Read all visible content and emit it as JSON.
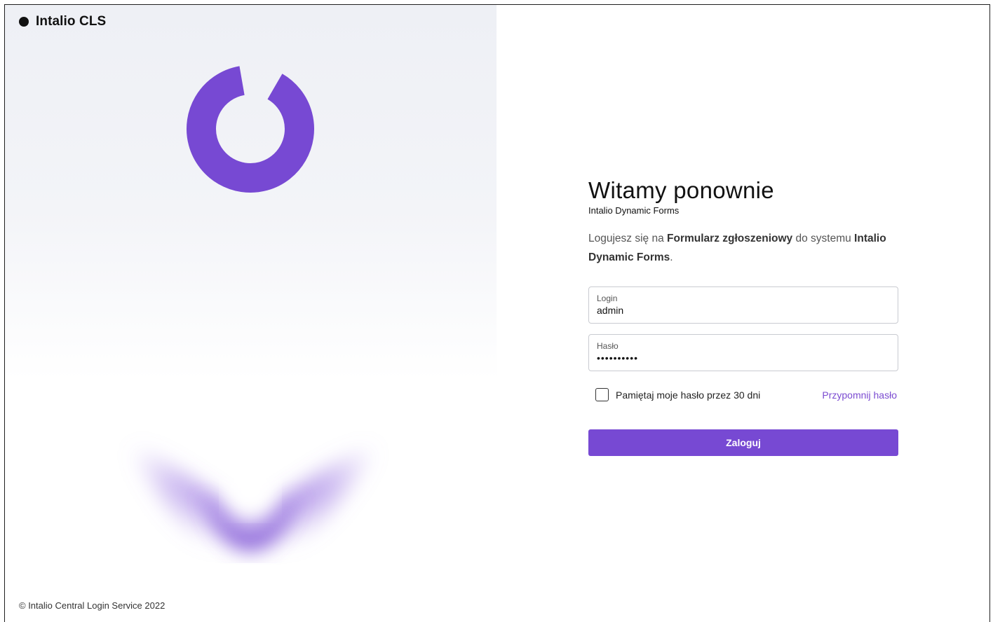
{
  "brand": {
    "name": "Intalio CLS"
  },
  "login": {
    "heading": "Witamy ponownie",
    "subheading": "Intalio Dynamic Forms",
    "description": {
      "part1": "Logujesz się na ",
      "form_name": "Formularz zgłoszeniowy",
      "part2": " do systemu ",
      "system_name": "Intalio Dynamic Forms",
      "part3": "."
    },
    "login_field": {
      "label": "Login",
      "value": "admin"
    },
    "password_field": {
      "label": "Hasło",
      "value": "••••••••••"
    },
    "remember_label": "Pamiętaj moje hasło przez 30 dni",
    "remember_checked": false,
    "forgot_link": "Przypomnij hasło",
    "submit_label": "Zaloguj"
  },
  "footer": {
    "text": "© Intalio Central Login Service 2022"
  },
  "colors": {
    "accent": "#7749d3",
    "link": "#7b4bd1",
    "panel_bg": "#eef0f5"
  },
  "icons": {
    "logo": "intalio-arc-logo",
    "brand_dot": "brand-dot-icon"
  }
}
